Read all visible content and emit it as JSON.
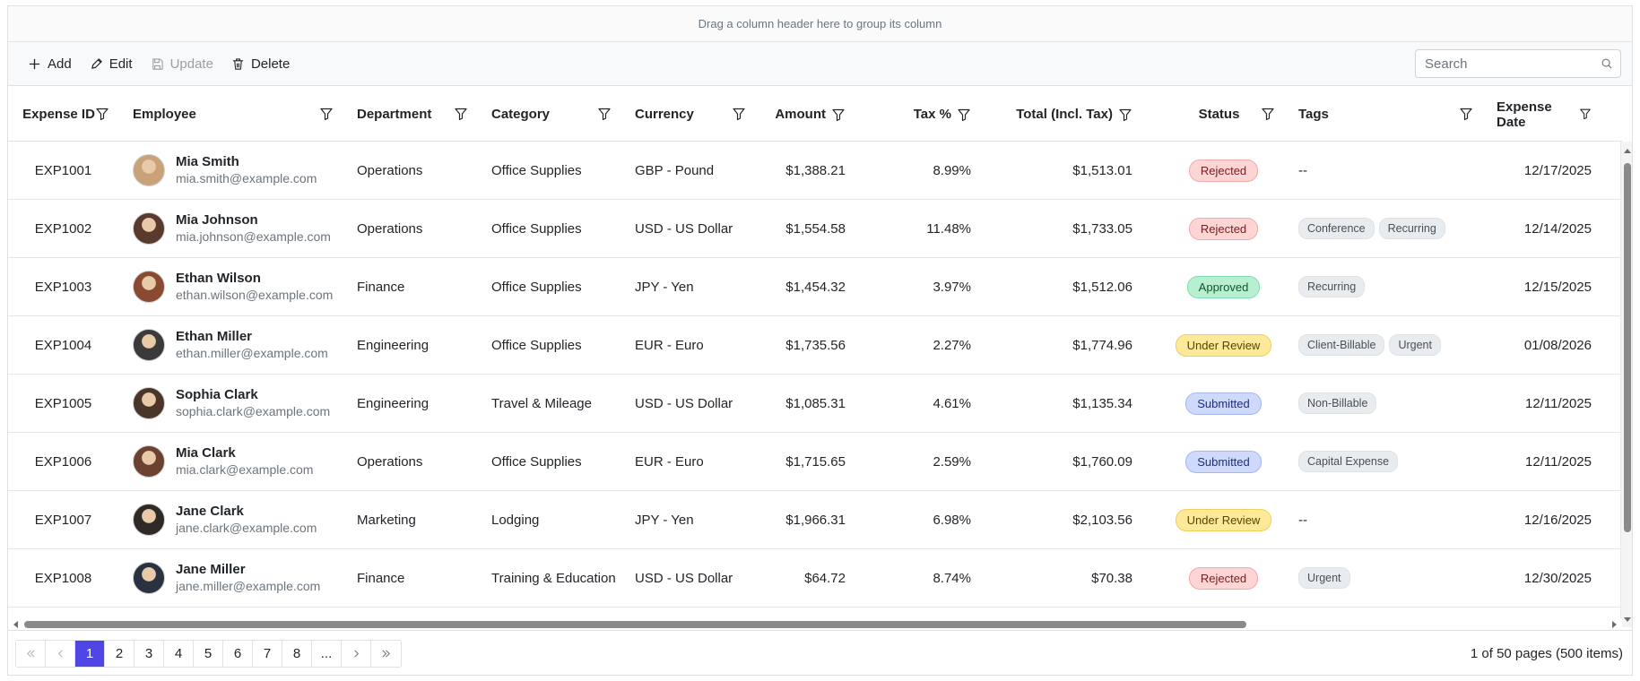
{
  "group_area_text": "Drag a column header here to group its column",
  "toolbar": {
    "add_label": "Add",
    "edit_label": "Edit",
    "update_label": "Update",
    "delete_label": "Delete",
    "search_placeholder": "Search"
  },
  "columns": {
    "expense_id": "Expense ID",
    "employee": "Employee",
    "department": "Department",
    "category": "Category",
    "currency": "Currency",
    "amount": "Amount",
    "tax": "Tax %",
    "total": "Total (Incl. Tax)",
    "status": "Status",
    "tags": "Tags",
    "expense_date": "Expense Date"
  },
  "status_colors": {
    "Rejected": {
      "bg": "#fdd5d5",
      "fg": "#7a1c1c",
      "border": "#f3a9a9"
    },
    "Approved": {
      "bg": "#b7efd1",
      "fg": "#14532d",
      "border": "#7fdcae"
    },
    "Under Review": {
      "bg": "#fde99a",
      "fg": "#5b4300",
      "border": "#f2cf55"
    },
    "Submitted": {
      "bg": "#cfd9fb",
      "fg": "#1e2f7a",
      "border": "#a3b6f3"
    }
  },
  "rows": [
    {
      "id": "EXP1001",
      "name": "Mia Smith",
      "email": "mia.smith@example.com",
      "department": "Operations",
      "category": "Office Supplies",
      "currency": "GBP - Pound",
      "amount": "$1,388.21",
      "tax": "8.99%",
      "total": "$1,513.01",
      "status": "Rejected",
      "tags": [],
      "empty_tags": "--",
      "date": "12/17/2025",
      "avatar_color": "#c9a27a"
    },
    {
      "id": "EXP1002",
      "name": "Mia Johnson",
      "email": "mia.johnson@example.com",
      "department": "Operations",
      "category": "Office Supplies",
      "currency": "USD - US Dollar",
      "amount": "$1,554.58",
      "tax": "11.48%",
      "total": "$1,733.05",
      "status": "Rejected",
      "tags": [
        "Conference",
        "Recurring"
      ],
      "empty_tags": "",
      "date": "12/14/2025",
      "avatar_color": "#5a3a2c"
    },
    {
      "id": "EXP1003",
      "name": "Ethan Wilson",
      "email": "ethan.wilson@example.com",
      "department": "Finance",
      "category": "Office Supplies",
      "currency": "JPY - Yen",
      "amount": "$1,454.32",
      "tax": "3.97%",
      "total": "$1,512.06",
      "status": "Approved",
      "tags": [
        "Recurring"
      ],
      "empty_tags": "",
      "date": "12/15/2025",
      "avatar_color": "#8a4a32"
    },
    {
      "id": "EXP1004",
      "name": "Ethan Miller",
      "email": "ethan.miller@example.com",
      "department": "Engineering",
      "category": "Office Supplies",
      "currency": "EUR - Euro",
      "amount": "$1,735.56",
      "tax": "2.27%",
      "total": "$1,774.96",
      "status": "Under Review",
      "tags": [
        "Client-Billable",
        "Urgent"
      ],
      "empty_tags": "",
      "date": "01/08/2026",
      "avatar_color": "#3a3a3a"
    },
    {
      "id": "EXP1005",
      "name": "Sophia Clark",
      "email": "sophia.clark@example.com",
      "department": "Engineering",
      "category": "Travel & Mileage",
      "currency": "USD - US Dollar",
      "amount": "$1,085.31",
      "tax": "4.61%",
      "total": "$1,135.34",
      "status": "Submitted",
      "tags": [
        "Non-Billable"
      ],
      "empty_tags": "",
      "date": "12/11/2025",
      "avatar_color": "#4a3528"
    },
    {
      "id": "EXP1006",
      "name": "Mia Clark",
      "email": "mia.clark@example.com",
      "department": "Operations",
      "category": "Office Supplies",
      "currency": "EUR - Euro",
      "amount": "$1,715.65",
      "tax": "2.59%",
      "total": "$1,760.09",
      "status": "Submitted",
      "tags": [
        "Capital Expense"
      ],
      "empty_tags": "",
      "date": "12/11/2025",
      "avatar_color": "#6b4232"
    },
    {
      "id": "EXP1007",
      "name": "Jane Clark",
      "email": "jane.clark@example.com",
      "department": "Marketing",
      "category": "Lodging",
      "currency": "JPY - Yen",
      "amount": "$1,966.31",
      "tax": "6.98%",
      "total": "$2,103.56",
      "status": "Under Review",
      "tags": [],
      "empty_tags": "--",
      "date": "12/16/2025",
      "avatar_color": "#2f2a28"
    },
    {
      "id": "EXP1008",
      "name": "Jane Miller",
      "email": "jane.miller@example.com",
      "department": "Finance",
      "category": "Training & Education",
      "currency": "USD - US Dollar",
      "amount": "$64.72",
      "tax": "8.74%",
      "total": "$70.38",
      "status": "Rejected",
      "tags": [
        "Urgent"
      ],
      "empty_tags": "",
      "date": "12/30/2025",
      "avatar_color": "#2a3140"
    }
  ],
  "pager": {
    "pages": [
      "1",
      "2",
      "3",
      "4",
      "5",
      "6",
      "7",
      "8",
      "..."
    ],
    "current": "1",
    "info": "1 of 50 pages (500 items)"
  },
  "accent_color": "#4f46e5"
}
